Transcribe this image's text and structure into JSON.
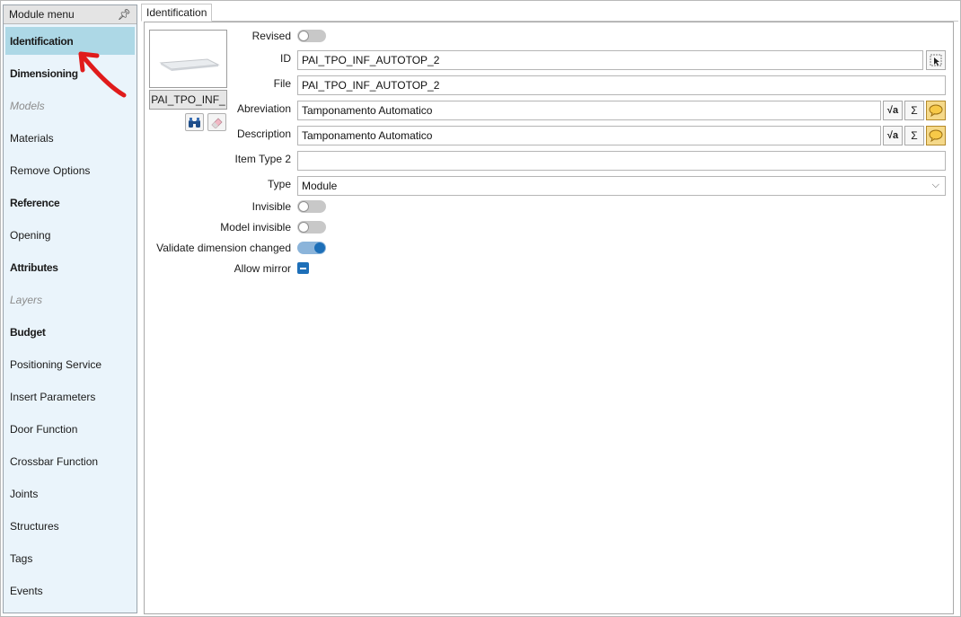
{
  "sidebar": {
    "title": "Module menu",
    "items": [
      {
        "label": "Identification",
        "style": "bold",
        "active": true
      },
      {
        "label": "Dimensioning",
        "style": "bold"
      },
      {
        "label": "Models",
        "style": "italic"
      },
      {
        "label": "Materials",
        "style": "normal"
      },
      {
        "label": "Remove Options",
        "style": "normal"
      },
      {
        "label": "Reference",
        "style": "bold"
      },
      {
        "label": "Opening",
        "style": "normal"
      },
      {
        "label": "Attributes",
        "style": "bold"
      },
      {
        "label": "Layers",
        "style": "italic"
      },
      {
        "label": "Budget",
        "style": "bold"
      },
      {
        "label": "Positioning Service",
        "style": "normal"
      },
      {
        "label": "Insert Parameters",
        "style": "normal"
      },
      {
        "label": "Door Function",
        "style": "normal"
      },
      {
        "label": "Crossbar Function",
        "style": "normal"
      },
      {
        "label": "Joints",
        "style": "normal"
      },
      {
        "label": "Structures",
        "style": "normal"
      },
      {
        "label": "Tags",
        "style": "normal"
      },
      {
        "label": "Events",
        "style": "normal"
      }
    ]
  },
  "tab": {
    "label": "Identification"
  },
  "thumbnail": {
    "name": "PAI_TPO_INF_"
  },
  "form": {
    "revised": {
      "label": "Revised",
      "on": false
    },
    "id": {
      "label": "ID",
      "value": "PAI_TPO_INF_AUTOTOP_2"
    },
    "file": {
      "label": "File",
      "value": "PAI_TPO_INF_AUTOTOP_2"
    },
    "abreviation": {
      "label": "Abreviation",
      "value": "Tamponamento Automatico"
    },
    "description": {
      "label": "Description",
      "value": "Tamponamento Automatico"
    },
    "item_type_2": {
      "label": "Item Type 2",
      "value": ""
    },
    "type": {
      "label": "Type",
      "value": "Module"
    },
    "invisible": {
      "label": "Invisible",
      "on": false
    },
    "model_invisible": {
      "label": "Model invisible",
      "on": false
    },
    "validate_dimension_changed": {
      "label": "Validate dimension changed",
      "on": true
    },
    "allow_mirror": {
      "label": "Allow mirror",
      "state": "indeterminate"
    }
  },
  "buttons": {
    "sigma": "Σ",
    "sqrt": "√a"
  },
  "colors": {
    "active_menu": "#add8e6",
    "sidebar_bg": "#eaf4fb",
    "toggle_on": "#1d6fb8",
    "annotation_arrow": "#e01b1b"
  }
}
